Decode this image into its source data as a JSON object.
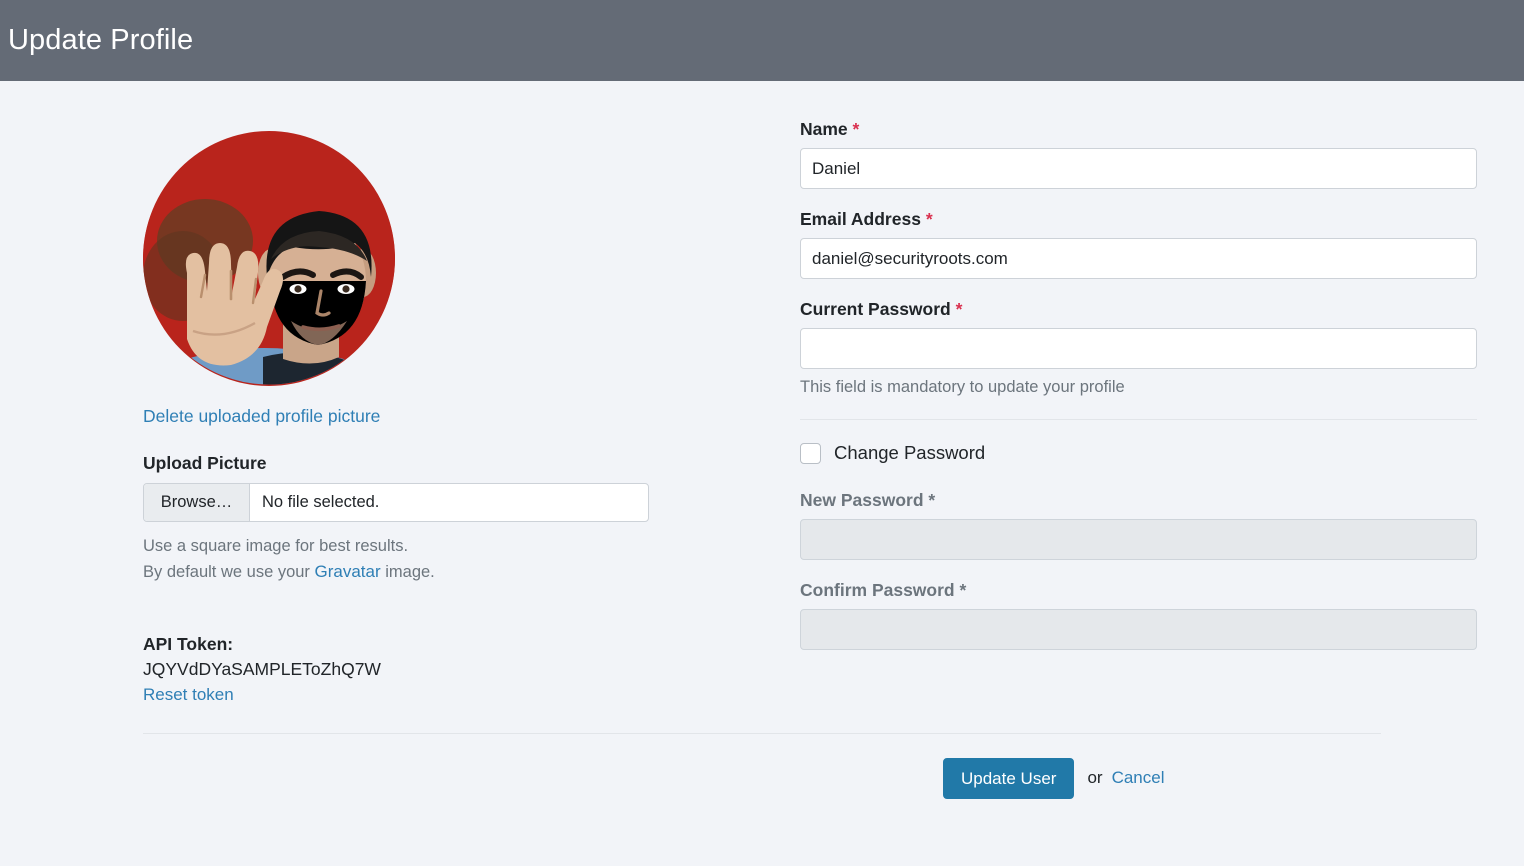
{
  "header": {
    "title": "Update Profile"
  },
  "profile_picture": {
    "avatar_alt": "spock-vulcan-salute-avatar",
    "delete_link": "Delete uploaded profile picture"
  },
  "upload": {
    "label": "Upload Picture",
    "browse_button": "Browse…",
    "file_status": "No file selected.",
    "hint_line1": "Use a square image for best results.",
    "hint_line2_before": "By default we use your ",
    "hint_link": "Gravatar",
    "hint_line2_after": " image."
  },
  "api_token": {
    "label": "API Token:",
    "value": "JQYVdDYaSAMPLEToZhQ7W",
    "reset_link": "Reset token"
  },
  "form": {
    "name": {
      "label": "Name",
      "required_mark": "*",
      "value": "Daniel",
      "placeholder": ""
    },
    "email": {
      "label": "Email Address",
      "required_mark": "*",
      "value": "daniel@securityroots.com",
      "placeholder": ""
    },
    "current_password": {
      "label": "Current Password",
      "required_mark": "*",
      "value": "",
      "placeholder": "",
      "help": "This field is mandatory to update your profile"
    },
    "change_password": {
      "label": "Change Password",
      "checked": false
    },
    "new_password": {
      "label": "New Password",
      "required_mark": "*",
      "value": "",
      "placeholder": "",
      "disabled": true
    },
    "confirm_password": {
      "label": "Confirm Password",
      "required_mark": "*",
      "value": "",
      "placeholder": "",
      "disabled": true
    }
  },
  "footer": {
    "submit_label": "Update User",
    "or_text": "or",
    "cancel_label": "Cancel"
  },
  "colors": {
    "header_bg": "#646b76",
    "page_bg": "#f2f4f8",
    "link": "#2f7fb5",
    "primary_button": "#2179a8",
    "required_asterisk": "#d9304f",
    "muted_text": "#6c757d",
    "input_border": "#cdd2d8",
    "disabled_field_bg": "#e5e8eb"
  }
}
